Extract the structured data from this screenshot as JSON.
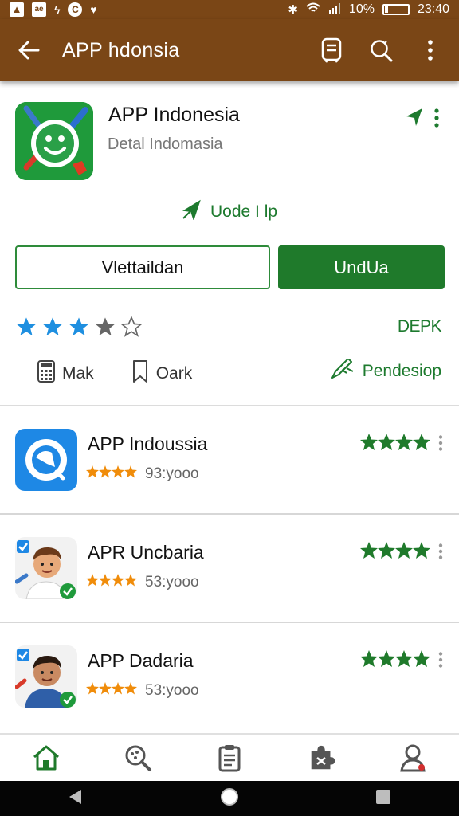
{
  "status": {
    "left_icons": [
      "a-icon",
      "ae-icon",
      "bolt-icon",
      "c-icon",
      "heart-icon"
    ],
    "battery": "10%",
    "time": "23:40"
  },
  "toolbar": {
    "title": "APP hdonsia",
    "icons": [
      "back-arrow-icon",
      "document-icon",
      "search-icon",
      "more-vert-icon"
    ]
  },
  "app": {
    "name": "APP Indonesia",
    "subtitle": "Detal Indomasia",
    "update_label": "Uode I lp",
    "secondary_button": "Vlettaildan",
    "primary_button": "UndUa",
    "rating": 3,
    "rating_max": 5,
    "badge": "DEPK",
    "meta": [
      {
        "icon": "calculator-icon",
        "label": "Mak"
      },
      {
        "icon": "bookmark-icon",
        "label": "Oark"
      }
    ],
    "pend_label": "Pendesiop"
  },
  "list": [
    {
      "name": "APP Indoussia",
      "downloads": "93:yooo",
      "rating": 4
    },
    {
      "name": "APR Uncbaria",
      "downloads": "53:yooo",
      "rating": 4
    },
    {
      "name": "APP Dadaria",
      "downloads": "53:yooo",
      "rating": 4
    }
  ],
  "colors": {
    "header": "#7a4616",
    "accent_green": "#1f7a2b",
    "star_blue": "#1e8fe0",
    "star_orange": "#f08c0a"
  },
  "bottom_nav": [
    "home-icon",
    "search-icon",
    "clipboard-icon",
    "puzzle-icon",
    "profile-icon"
  ],
  "system_nav": [
    "back-triangle-icon",
    "home-circle-icon",
    "recents-square-icon"
  ]
}
